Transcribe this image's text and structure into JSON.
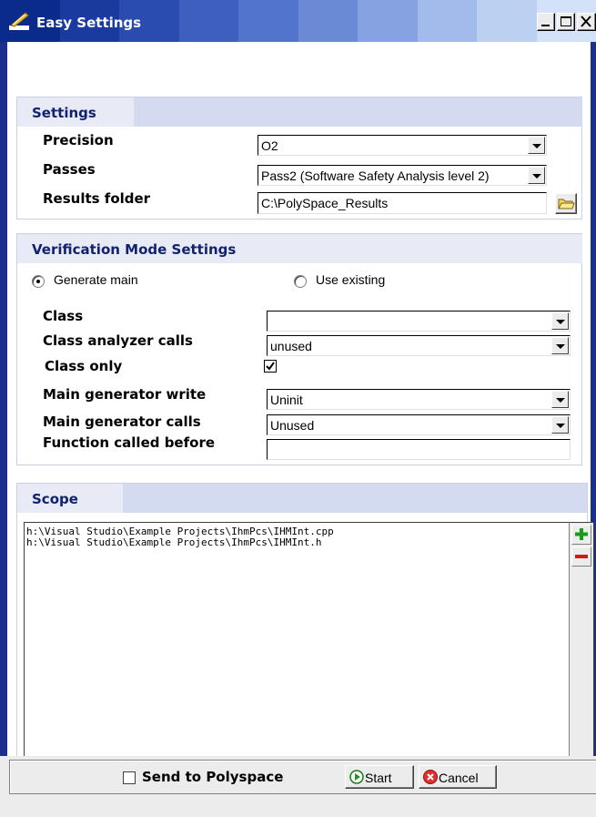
{
  "window": {
    "title": "Easy Settings",
    "buttons": {
      "minimize": "minimize",
      "maximize": "maximize",
      "close": "close"
    }
  },
  "settings": {
    "header": "Settings",
    "precision_label": "Precision",
    "precision_value": "O2",
    "passes_label": "Passes",
    "passes_value": "Pass2 (Software Safety Analysis level 2)",
    "results_folder_label": "Results folder",
    "results_folder_value": "C:\\PolySpace_Results"
  },
  "verification": {
    "header": "Verification Mode Settings",
    "generate_main_label": "Generate main",
    "generate_main_selected": true,
    "use_existing_label": "Use existing",
    "class_label": "Class",
    "class_value": "",
    "class_analyzer_calls_label": "Class analyzer calls",
    "class_analyzer_calls_value": "unused",
    "class_only_label": "Class only",
    "class_only_checked": true,
    "main_generator_write_label": "Main generator write",
    "main_generator_write_value": "Uninit",
    "main_generator_calls_label": "Main generator calls",
    "main_generator_calls_value": "Unused",
    "function_called_before_label": "Function called before",
    "function_called_before_value": ""
  },
  "scope": {
    "header": "Scope",
    "files": [
      "h:\\Visual Studio\\Example Projects\\IhmPcs\\IHMInt.cpp",
      "h:\\Visual Studio\\Example Projects\\IhmPcs\\IHMInt.h"
    ]
  },
  "footer": {
    "send_to_polyspace_label": "Send to Polyspace",
    "send_to_polyspace_checked": false,
    "start_label": "Start",
    "cancel_label": "Cancel"
  },
  "colors": {
    "frame": "#1b2f8c",
    "header_text": "#12226e",
    "header_bg": "#e8ebf6",
    "add_green": "#1a9a1a",
    "remove_red": "#d01818"
  },
  "icons": {
    "app": "app-feather-icon",
    "folder": "folder-icon",
    "add": "plus-icon",
    "remove": "minus-icon",
    "start": "play-icon",
    "cancel": "cancel-icon"
  }
}
